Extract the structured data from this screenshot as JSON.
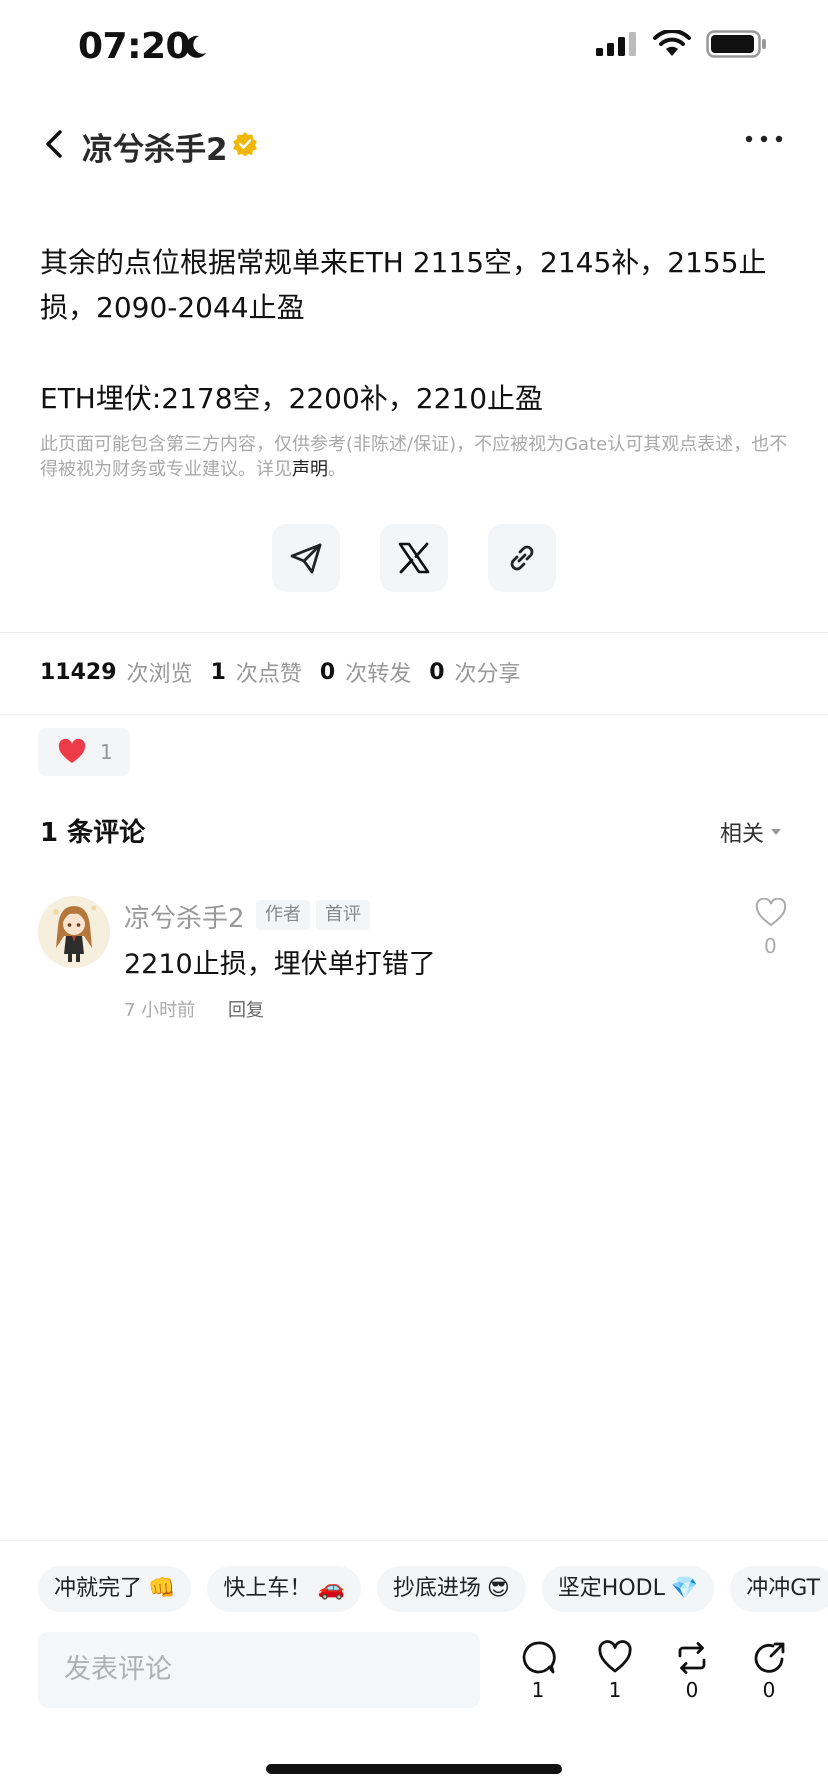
{
  "status_bar": {
    "time": "07:20"
  },
  "header": {
    "title": "凉兮杀手2"
  },
  "post": {
    "paragraph_1": "其余的点位根据常规单来ETH 2115空，2145补，2155止损，2090-2044止盈",
    "paragraph_2": "ETH埋伏:2178空，2200补，2210止盈",
    "disclaimer": "此页面可能包含第三方内容，仅供参考(非陈述/保证)，不应被视为Gate认可其观点表述，也不得被视为财务或专业建议。详见",
    "disclaimer_link": "声明",
    "disclaimer_end": "。"
  },
  "stats": {
    "views": "11429",
    "views_label": "次浏览",
    "likes": "1",
    "likes_label": "次点赞",
    "reposts": "0",
    "reposts_label": "次转发",
    "shares": "0",
    "shares_label": "次分享"
  },
  "reaction": {
    "count": "1"
  },
  "comments": {
    "title": "1 条评论",
    "sort_label": "相关",
    "items": [
      {
        "author": "凉兮杀手2",
        "tag_author": "作者",
        "tag_first": "首评",
        "text": "2210止损，埋伏单打错了",
        "time": "7 小时前",
        "reply_label": "回复",
        "like_count": "0"
      }
    ]
  },
  "quick_chips": [
    {
      "label": "冲就完了",
      "emoji": "👊"
    },
    {
      "label": "快上车！",
      "emoji": "🚗"
    },
    {
      "label": "抄底进场",
      "emoji": "😎"
    },
    {
      "label": "坚定HODL",
      "emoji": "💎"
    },
    {
      "label": "冲冲GT",
      "emoji": ""
    }
  ],
  "composer": {
    "placeholder": "发表评论"
  },
  "actions": {
    "comment_count": "1",
    "like_count": "1",
    "repost_count": "0",
    "share_count": "0"
  },
  "colors": {
    "verified_badge": "#f2b705",
    "heart": "#ee3b4a",
    "text_primary": "#111111",
    "text_muted": "#a9a9a9"
  }
}
